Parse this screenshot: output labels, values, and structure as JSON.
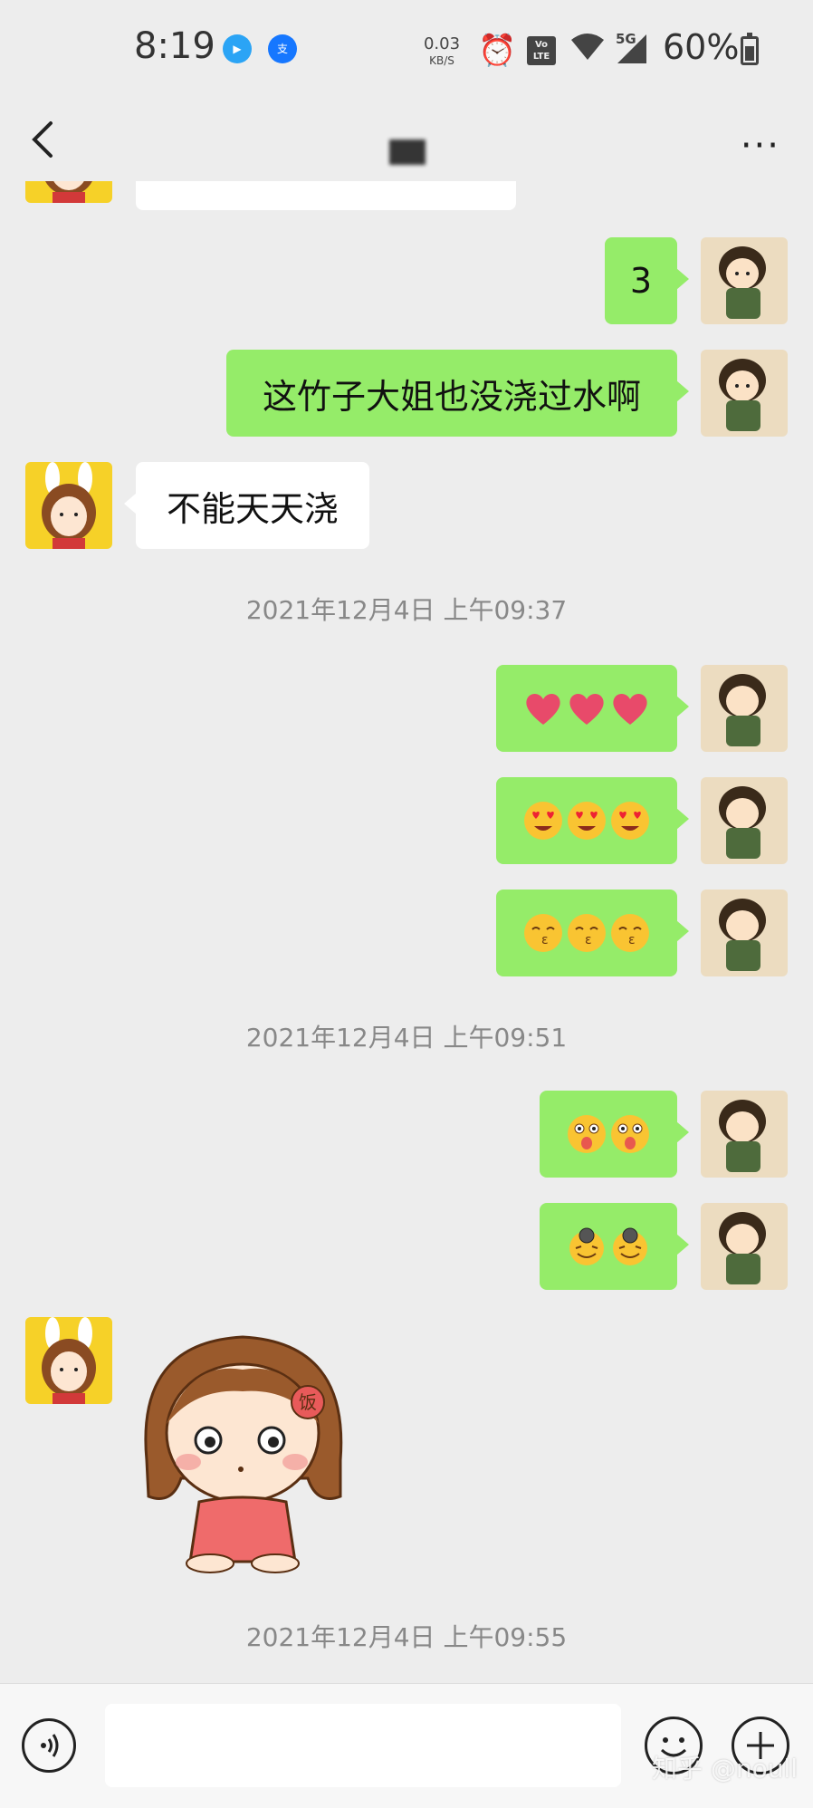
{
  "status_bar": {
    "time": "8:19",
    "net_speed": "0.03",
    "net_speed_unit": "KB/S",
    "volte": "Vo LTE",
    "network": "5G",
    "battery": "60%"
  },
  "header": {
    "back_icon": "chevron-left-icon",
    "more_icon": "ellipsis-icon",
    "more_label": "···"
  },
  "messages": [
    {
      "side": "received",
      "text": ""
    },
    {
      "side": "sent",
      "text": "3"
    },
    {
      "side": "sent",
      "text": "这竹子大姐也没浇过水啊"
    },
    {
      "side": "received",
      "text": "不能天天浇"
    },
    {
      "type": "time",
      "text": "2021年12月4日 上午09:37"
    },
    {
      "side": "sent",
      "emoji": [
        "red-heart",
        "red-heart",
        "red-heart"
      ]
    },
    {
      "side": "sent",
      "emoji": [
        "heart-eyes-drool",
        "heart-eyes-drool",
        "heart-eyes-drool"
      ]
    },
    {
      "side": "sent",
      "emoji": [
        "kissing-face",
        "kissing-face",
        "kissing-face"
      ]
    },
    {
      "type": "time",
      "text": "2021年12月4日 上午09:51"
    },
    {
      "side": "sent",
      "emoji": [
        "tongue-out-face",
        "tongue-out-face"
      ]
    },
    {
      "side": "sent",
      "emoji": [
        "smirk-glasses-face",
        "smirk-glasses-face"
      ]
    },
    {
      "side": "received",
      "sticker": "girl-sticker",
      "sticker_text": "饭"
    },
    {
      "type": "time",
      "text": "2021年12月4日 上午09:55"
    }
  ],
  "timestamps": {
    "t1": "2021年12月4日 上午09:37",
    "t2": "2021年12月4日 上午09:51",
    "t3": "2021年12月4日 上午09:55"
  },
  "bubbles": {
    "b_3": "3",
    "b_bamboo": "这竹子大姐也没浇过水啊",
    "b_water": "不能天天浇"
  },
  "sticker_label": "饭",
  "input": {
    "placeholder": "",
    "value": ""
  },
  "watermark": "知乎 @noull",
  "colors": {
    "sent_bubble": "#95ec69",
    "received_bubble": "#ffffff",
    "background": "#ededed"
  }
}
